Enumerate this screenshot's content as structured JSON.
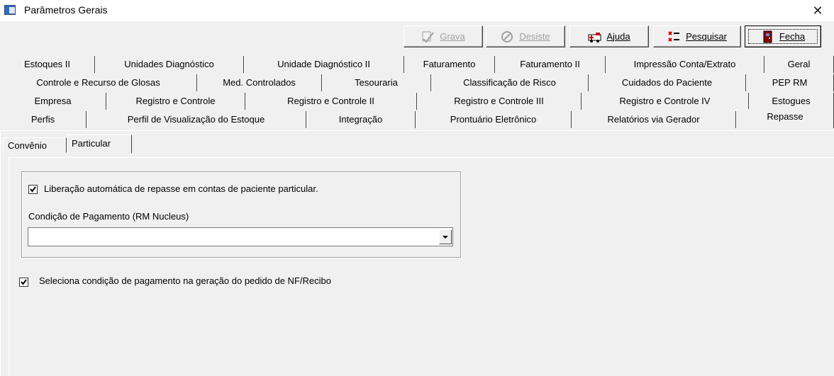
{
  "window": {
    "title": "Parâmetros Gerais",
    "close": "✕"
  },
  "toolbar": {
    "grava": "Grava",
    "desiste": "Desiste",
    "ajuda": "Ajuda",
    "pesquisar": "Pesquisar",
    "fecha": "Fecha"
  },
  "tabs": {
    "row1": [
      "Estoques II",
      "Unidades Diagnóstico",
      "Unidade Diagnóstico II",
      "Faturamento",
      "Faturamento II",
      "Impressão Conta/Extrato",
      "Geral"
    ],
    "row2": [
      "Controle e Recurso de Glosas",
      "Med. Controlados",
      "Tesouraria",
      "Classificação de Risco",
      "Cuidados do Paciente",
      "PEP RM"
    ],
    "row3": [
      "Empresa",
      "Registro e Controle",
      "Registro e Controle II",
      "Registro e Controle III",
      "Registro e Controle IV",
      "Estogues"
    ],
    "row4": [
      "Perfis",
      "Perfil de Visualização do Estoque",
      "Integração",
      "Prontuário Eletrônico",
      "Relatórios via Gerador",
      "Repasse"
    ]
  },
  "subtabs": [
    "Convênio",
    "Particular"
  ],
  "form": {
    "liberacao_label": "Liberação automática de repasse em contas de paciente particular.",
    "liberacao_checked": true,
    "condicao_label": "Condição de Pagamento (RM Nucleus)",
    "condicao_value": "",
    "seleciona_label": "Seleciona condição de pagamento na geração do pedido de NF/Recibo",
    "seleciona_checked": true
  }
}
